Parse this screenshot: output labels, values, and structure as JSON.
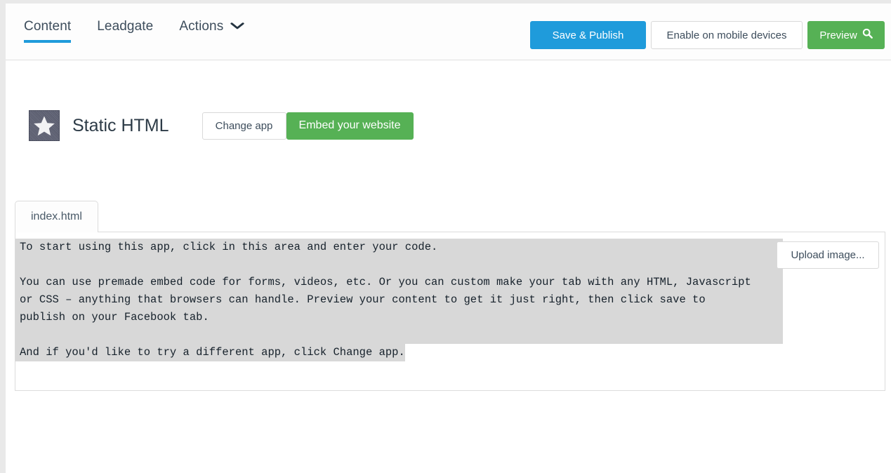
{
  "nav": {
    "items": [
      {
        "label": "Content",
        "active": true,
        "has_chevron": false
      },
      {
        "label": "Leadgate",
        "active": false,
        "has_chevron": false
      },
      {
        "label": "Actions",
        "active": false,
        "has_chevron": true
      }
    ],
    "chevron_glyph": "⌄",
    "active_underline_color": "#1f9bdb"
  },
  "toolbar": {
    "save_publish_label": "Save & Publish",
    "enable_mobile_label": "Enable on mobile devices",
    "preview_label": "Preview",
    "preview_icon_glyph": "🔍",
    "save_publish_color": "#1f9bdb",
    "preview_color": "#56b155"
  },
  "app": {
    "icon_name": "star-icon",
    "title": "Static HTML",
    "change_app_label": "Change app",
    "embed_label": "Embed your website",
    "embed_color": "#56b155"
  },
  "editor": {
    "tabs": [
      {
        "label": "index.html",
        "active": true
      }
    ],
    "upload_label": "Upload image...",
    "selection_color": "#d8d8d8",
    "lines": [
      {
        "text": "To start using this app, click in this area and enter your code.",
        "selection": "full"
      },
      {
        "text": "",
        "selection": "full"
      },
      {
        "text": "You can use premade embed code for forms, videos, etc. Or you can custom make your tab with any HTML, Javascript",
        "selection": "full"
      },
      {
        "text": "or CSS – anything that browsers can handle. Preview your content to get it just right, then click save to",
        "selection": "full"
      },
      {
        "text": "publish on your Facebook tab.",
        "selection": "full"
      },
      {
        "text": "",
        "selection": "full"
      },
      {
        "text": "And if you'd like to try a different app, click Change app.",
        "selection": "partial"
      }
    ]
  }
}
